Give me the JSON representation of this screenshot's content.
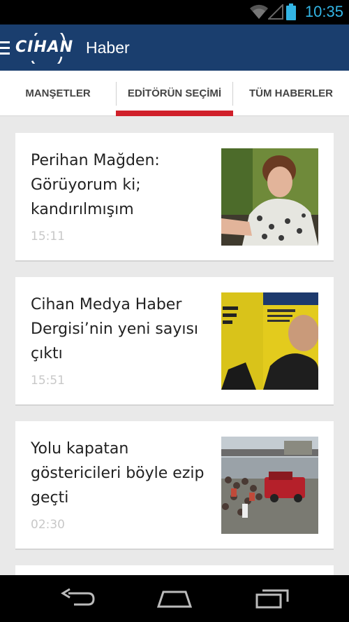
{
  "status_bar": {
    "time": "10:35",
    "icons": [
      "wifi-icon",
      "signal-icon",
      "battery-icon"
    ],
    "clock_color": "#33b5e5"
  },
  "app_bar": {
    "logo_text": "CIHAN",
    "title": "Haber",
    "background": "#1a3e6e"
  },
  "tabs": [
    {
      "label": "MANŞETLER",
      "selected": false
    },
    {
      "label": "EDİTÖRÜN SEÇİMİ",
      "selected": true
    },
    {
      "label": "TÜM HABERLER",
      "selected": false
    }
  ],
  "accent_color": "#d0202a",
  "articles": [
    {
      "headline": "Perihan Mağden: Görüyorum ki; kandırılmışım",
      "time": "15:11",
      "thumbnail": "portrait-photo"
    },
    {
      "headline": "Cihan Medya Haber Dergisi’nin yeni sayısı çıktı",
      "time": "15:51",
      "thumbnail": "magazine-cover-photo"
    },
    {
      "headline": "Yolu kapatan göstericileri böyle ezip geçti",
      "time": "02:30",
      "thumbnail": "street-protest-photo"
    }
  ],
  "nav_bar": {
    "icons": [
      "back-icon",
      "home-icon",
      "recent-apps-icon"
    ]
  }
}
